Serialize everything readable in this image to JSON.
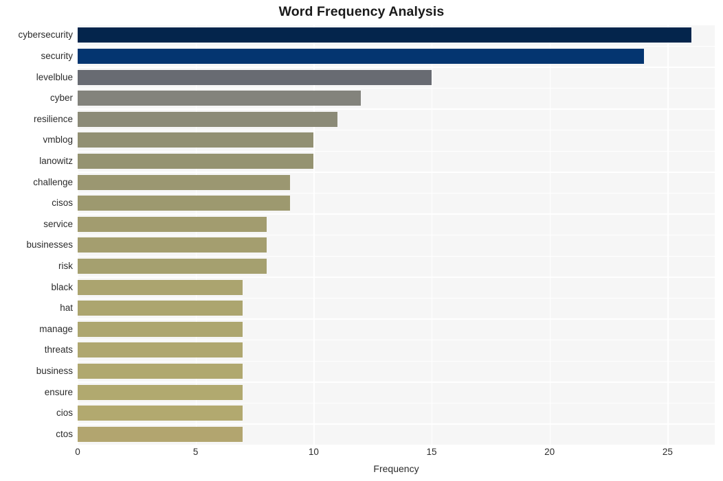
{
  "chart_data": {
    "type": "bar",
    "orientation": "horizontal",
    "title": "Word Frequency Analysis",
    "xlabel": "Frequency",
    "ylabel": "",
    "xlim": [
      0,
      27
    ],
    "xticks": [
      0,
      5,
      10,
      15,
      20,
      25
    ],
    "xtick_labels": [
      "0",
      "5",
      "10",
      "15",
      "20",
      "25"
    ],
    "grid": true,
    "grid_color": "#ffffff",
    "plot_background": "#f6f6f6",
    "figure_background": "#ffffff",
    "legend": null,
    "categories": [
      "cybersecurity",
      "security",
      "levelblue",
      "cyber",
      "resilience",
      "vmblog",
      "lanowitz",
      "challenge",
      "cisos",
      "service",
      "businesses",
      "risk",
      "black",
      "hat",
      "manage",
      "threats",
      "business",
      "ensure",
      "cios",
      "ctos"
    ],
    "values": [
      26,
      24,
      15,
      12,
      11,
      10,
      10,
      9,
      9,
      8,
      8,
      8,
      7,
      7,
      7,
      7,
      7,
      7,
      7,
      7
    ],
    "bar_colors": [
      "#04254c",
      "#043570",
      "#686b72",
      "#83837c",
      "#8b8a77",
      "#929073",
      "#959371",
      "#9b9771",
      "#9d996f",
      "#a29c6f",
      "#a49e6f",
      "#a5a06f",
      "#aba46f",
      "#aca56f",
      "#ada66f",
      "#afa76f",
      "#b0a86f",
      "#b1a96f",
      "#b2a96f",
      "#b2a56f"
    ]
  }
}
